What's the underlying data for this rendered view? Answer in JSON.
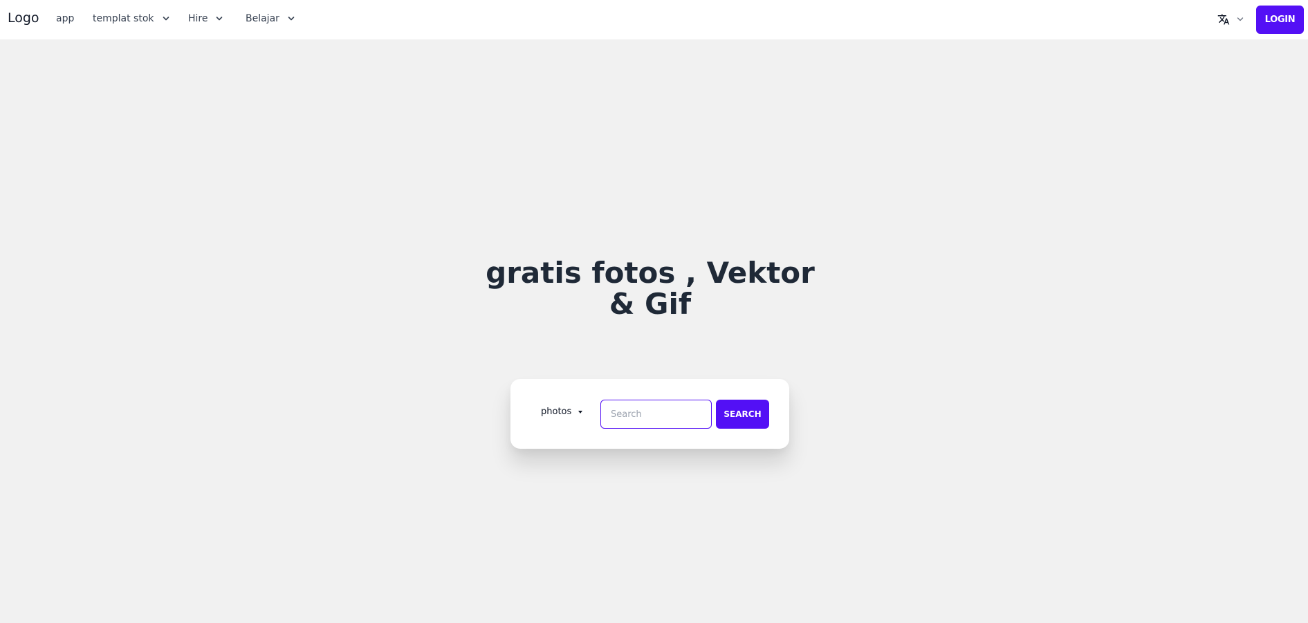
{
  "navbar": {
    "logo": "Logo",
    "items": [
      {
        "label": "app"
      },
      {
        "label": "templat stok"
      },
      {
        "label": "Hire"
      },
      {
        "label": "Belajar"
      }
    ],
    "language_icon": "translate-icon",
    "login_label": "LOGIN"
  },
  "hero": {
    "title": "gratis fotos , Vektor & Gif"
  },
  "search": {
    "type_selected": "photos",
    "placeholder": "Search",
    "value": "",
    "button_label": "SEARCH"
  },
  "colors": {
    "accent": "#5310f5",
    "background": "#f1f1f1",
    "text_dark": "#1f2937"
  }
}
